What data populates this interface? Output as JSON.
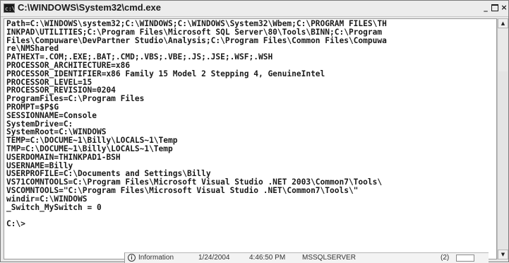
{
  "window": {
    "title": "C:\\WINDOWS\\System32\\cmd.exe",
    "icon_text": "c:\\"
  },
  "console": {
    "lines": [
      "Path=C:\\WINDOWS\\system32;C:\\WINDOWS;C:\\WINDOWS\\System32\\Wbem;C:\\PROGRAM FILES\\TH",
      "INKPAD\\UTILITIES;C:\\Program Files\\Microsoft SQL Server\\80\\Tools\\BINN;C:\\Program",
      "Files\\Compuware\\DevPartner Studio\\Analysis;C:\\Program Files\\Common Files\\Compuwa",
      "re\\NMShared",
      "PATHEXT=.COM;.EXE;.BAT;.CMD;.VBS;.VBE;.JS;.JSE;.WSF;.WSH",
      "PROCESSOR_ARCHITECTURE=x86",
      "PROCESSOR_IDENTIFIER=x86 Family 15 Model 2 Stepping 4, GenuineIntel",
      "PROCESSOR_LEVEL=15",
      "PROCESSOR_REVISION=0204",
      "ProgramFiles=C:\\Program Files",
      "PROMPT=$P$G",
      "SESSIONNAME=Console",
      "SystemDrive=C:",
      "SystemRoot=C:\\WINDOWS",
      "TEMP=C:\\DOCUME~1\\Billy\\LOCALS~1\\Temp",
      "TMP=C:\\DOCUME~1\\Billy\\LOCALS~1\\Temp",
      "USERDOMAIN=THINKPAD1-BSH",
      "USERNAME=Billy",
      "USERPROFILE=C:\\Documents and Settings\\Billy",
      "VS71COMNTOOLS=C:\\Program Files\\Microsoft Visual Studio .NET 2003\\Common7\\Tools\\",
      "VSCOMNTOOLS=\"C:\\Program Files\\Microsoft Visual Studio .NET\\Common7\\Tools\\\"",
      "windir=C:\\WINDOWS",
      "_Switch_MySwitch = 0",
      "",
      "C:\\>"
    ]
  },
  "background_event_row": {
    "icon_glyph": "i",
    "type": "Information",
    "date": "1/24/2004",
    "time": "4:46:50 PM",
    "source": "MSSQLSERVER",
    "category": "(2)"
  },
  "scrollbar": {
    "up_glyph": "▲",
    "down_glyph": "▼"
  }
}
